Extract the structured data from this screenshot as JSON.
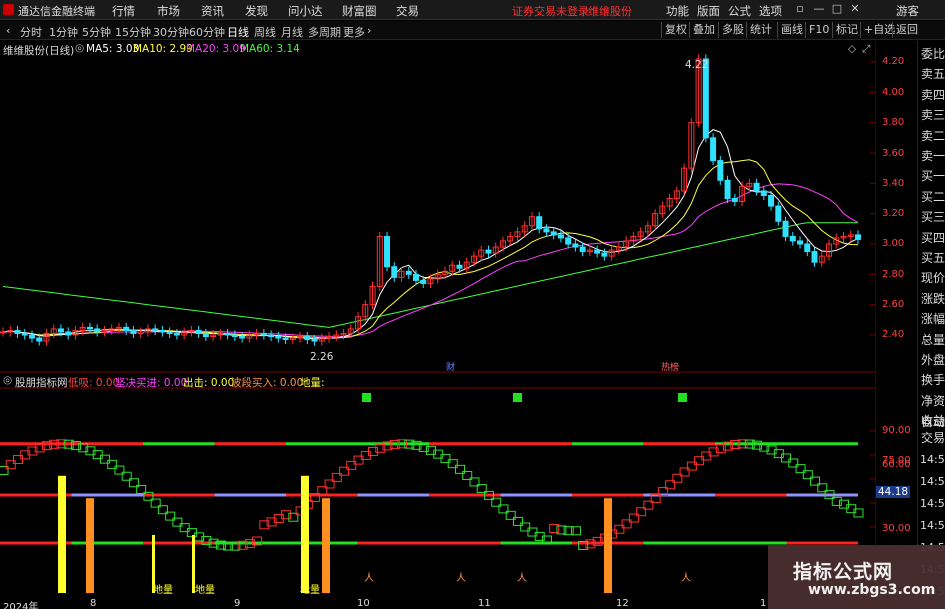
{
  "titlebar": {
    "app_title": "通达信金融终端",
    "menu": [
      "行情",
      "市场",
      "资讯",
      "发现",
      "问小达",
      "财富圈",
      "交易"
    ],
    "alert": "证券交易未登录",
    "stock_name_top": "维维股份",
    "right_menu": [
      "功能",
      "版面",
      "公式",
      "选项"
    ],
    "guest": "游客"
  },
  "toolbar": {
    "periods": [
      "分时",
      "1分钟",
      "5分钟",
      "15分钟",
      "30分钟",
      "60分钟",
      "日线",
      "周线",
      "月线",
      "多周期",
      "更多"
    ],
    "active_period": "日线",
    "right_buttons": [
      "复权",
      "叠加",
      "多股",
      "统计",
      "画线",
      "F10",
      "标记",
      "+自选",
      "返回"
    ]
  },
  "main_chart": {
    "title": "维维股份(日线)",
    "ma_legend": [
      {
        "label": "MA5:",
        "value": "3.03",
        "color": "#ffffff"
      },
      {
        "label": "MA10:",
        "value": "2.99",
        "color": "#ffff40"
      },
      {
        "label": "MA20:",
        "value": "3.09",
        "color": "#ff40ff"
      },
      {
        "label": "MA60:",
        "value": "3.14",
        "color": "#40ff40"
      }
    ],
    "price_ticks": [
      "4.20",
      "4.00",
      "3.80",
      "3.60",
      "3.40",
      "3.20",
      "3.00",
      "2.80",
      "2.60",
      "2.40"
    ],
    "high_label": "4.22",
    "low_label": "2.26",
    "markers": [
      "财",
      "热榜"
    ]
  },
  "sub_chart": {
    "title": "股朋指标网",
    "legend": [
      {
        "label": "低吸:",
        "value": "0.00",
        "color": "#ff4040"
      },
      {
        "label": "坚决买进:",
        "value": "0.00",
        "color": "#ff40ff"
      },
      {
        "label": "出击:",
        "value": "0.00",
        "color": "#ffff40"
      },
      {
        "label": "波段买入:",
        "value": "0.00",
        "color": "#ff9040"
      },
      {
        "label": "地量:",
        "value": "",
        "color": "#ffff40"
      }
    ],
    "ticks": [
      "90.00",
      "75.00",
      "60.00",
      "45.00",
      "30.00"
    ],
    "current_value": "44.18",
    "dili_labels": [
      "地量",
      "地量",
      "地量"
    ]
  },
  "x_labels": [
    "2024年",
    "8",
    "9",
    "10",
    "11",
    "12",
    "1"
  ],
  "side_panel": {
    "items": [
      "委比",
      "卖五",
      "卖四",
      "卖三",
      "卖二",
      "卖一",
      "买一",
      "买二",
      "买三",
      "买四",
      "买五",
      "现价",
      "涨跌",
      "涨幅",
      "总量",
      "外盘",
      "换手",
      "净资",
      "收益"
    ],
    "sub_items": [
      "自动",
      "交易"
    ],
    "times": [
      "14:56",
      "14:56",
      "14:56",
      "14:56",
      "14:56",
      "14:56",
      "14:56"
    ]
  },
  "watermark": {
    "line1": "指标公式网",
    "line2": "www.zbgs3.com"
  },
  "chart_data": {
    "type": "candlestick",
    "title": "维维股份(日线)",
    "ylim": [
      2.2,
      4.3
    ],
    "moving_averages": {
      "MA5": 3.03,
      "MA10": 2.99,
      "MA20": 3.09,
      "MA60": 3.14
    },
    "closes": [
      2.42,
      2.43,
      2.41,
      2.4,
      2.38,
      2.36,
      2.41,
      2.44,
      2.42,
      2.4,
      2.43,
      2.45,
      2.44,
      2.42,
      2.43,
      2.44,
      2.45,
      2.43,
      2.41,
      2.42,
      2.44,
      2.43,
      2.42,
      2.41,
      2.4,
      2.42,
      2.43,
      2.41,
      2.39,
      2.4,
      2.41,
      2.4,
      2.39,
      2.38,
      2.4,
      2.41,
      2.4,
      2.39,
      2.38,
      2.37,
      2.38,
      2.39,
      2.37,
      2.36,
      2.38,
      2.39,
      2.4,
      2.41,
      2.44,
      2.52,
      2.6,
      2.72,
      3.05,
      2.85,
      2.78,
      2.82,
      2.8,
      2.76,
      2.74,
      2.77,
      2.8,
      2.82,
      2.86,
      2.84,
      2.88,
      2.92,
      2.96,
      2.94,
      2.98,
      3.02,
      3.05,
      3.08,
      3.12,
      3.18,
      3.1,
      3.08,
      3.06,
      3.04,
      3.0,
      2.98,
      2.95,
      2.96,
      2.94,
      2.92,
      2.96,
      2.98,
      3.02,
      3.05,
      3.08,
      3.12,
      3.2,
      3.25,
      3.3,
      3.35,
      3.5,
      3.8,
      4.22,
      3.7,
      3.55,
      3.42,
      3.3,
      3.28,
      3.38,
      3.4,
      3.35,
      3.32,
      3.25,
      3.15,
      3.05,
      3.02,
      3.0,
      2.95,
      2.88,
      2.92,
      3.0,
      3.04,
      3.05,
      3.06,
      3.03
    ],
    "sub_indicator": {
      "ticks": [
        90,
        75,
        60,
        45,
        30
      ],
      "current": 44.18,
      "levels": [
        82,
        50,
        20
      ]
    }
  }
}
